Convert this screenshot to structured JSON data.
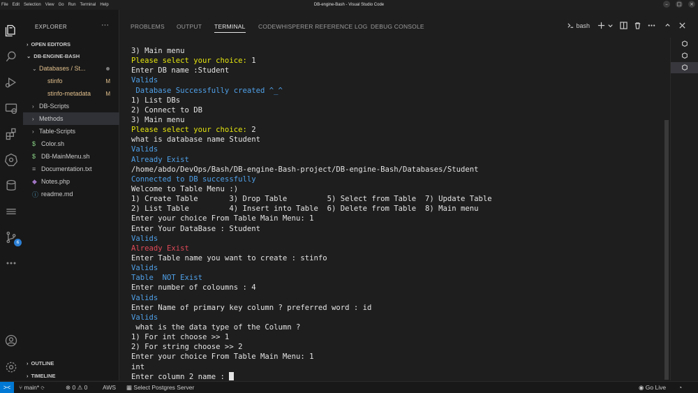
{
  "window": {
    "title": "DB-engine-Bash - Visual Studio Code",
    "menu": [
      "File",
      "Edit",
      "Selection",
      "View",
      "Go",
      "Run",
      "Terminal",
      "Help"
    ]
  },
  "activity_bar": {
    "icons": [
      "files-icon",
      "search-icon",
      "run-debug-icon",
      "remote-explorer-icon",
      "extensions-icon",
      "kubernetes-icon",
      "database-icon",
      "stack-icon",
      "source-control-icon",
      "more-icon",
      "account-icon",
      "settings-gear-icon"
    ],
    "source_control_badge": "6"
  },
  "sidebar": {
    "title": "EXPLORER",
    "more": "···",
    "open_editors": "OPEN EDITORS",
    "project": "DB-ENGINE-BASH",
    "items": [
      {
        "label": "Databases / St...",
        "type": "folder-open",
        "indent": 1,
        "status": "dot"
      },
      {
        "label": "stinfo",
        "type": "file",
        "indent": 2,
        "status": "M"
      },
      {
        "label": "stinfo-metadata",
        "type": "file",
        "indent": 2,
        "status": "M"
      },
      {
        "label": "DB-Scripts",
        "type": "folder",
        "indent": 1,
        "status": ""
      },
      {
        "label": "Methods",
        "type": "folder",
        "indent": 1,
        "status": ""
      },
      {
        "label": "Table-Scripts",
        "type": "folder",
        "indent": 1,
        "status": ""
      },
      {
        "label": "Color.sh",
        "type": "shell",
        "indent": 1,
        "status": ""
      },
      {
        "label": "DB-MainMenu.sh",
        "type": "shell",
        "indent": 1,
        "status": ""
      },
      {
        "label": "Documentation.txt",
        "type": "text",
        "indent": 1,
        "status": ""
      },
      {
        "label": "Notes.php",
        "type": "php",
        "indent": 1,
        "status": ""
      },
      {
        "label": "readme.md",
        "type": "info",
        "indent": 1,
        "status": ""
      }
    ],
    "outline": "OUTLINE",
    "timeline": "TIMELINE"
  },
  "panel": {
    "tabs": [
      "PROBLEMS",
      "OUTPUT",
      "TERMINAL",
      "CODEWHISPERER REFERENCE LOG",
      "DEBUG CONSOLE"
    ],
    "active_tab": "TERMINAL",
    "shell_label": "bash"
  },
  "terminal": {
    "lines": [
      {
        "text": "3) Main menu",
        "color": "default"
      },
      {
        "text": "Please select your choice: ",
        "color": "yellow",
        "suffix": "1"
      },
      {
        "text": "Enter DB name :Student",
        "color": "default"
      },
      {
        "text": "Valids",
        "color": "blue"
      },
      {
        "text": " Database Successfully created ^_^",
        "color": "blue"
      },
      {
        "text": "1) List DBs",
        "color": "default"
      },
      {
        "text": "2) Connect to DB",
        "color": "default"
      },
      {
        "text": "3) Main menu",
        "color": "default"
      },
      {
        "text": "Please select your choice: ",
        "color": "yellow",
        "suffix": "2"
      },
      {
        "text": "what is database name Student",
        "color": "default"
      },
      {
        "text": "Valids",
        "color": "blue"
      },
      {
        "text": "Already Exist",
        "color": "blue"
      },
      {
        "text": "/home/abdo/DevOps/Bash/DB-engine-Bash-project/DB-engine-Bash/Databases/Student",
        "color": "default"
      },
      {
        "text": "Connected to DB successfully",
        "color": "blue"
      },
      {
        "text": "Welcome to Table Menu :)",
        "color": "default"
      },
      {
        "text": "1) Create Table       3) Drop Table         5) Select from Table  7) Update Table",
        "color": "default"
      },
      {
        "text": "2) List Table         4) Insert into Table  6) Delete from Table  8) Main menu",
        "color": "default"
      },
      {
        "text": "Enter your choice From Table Main Menu: 1",
        "color": "default"
      },
      {
        "text": "Enter Your DataBase : Student",
        "color": "default"
      },
      {
        "text": "Valids",
        "color": "blue"
      },
      {
        "text": "Already Exist",
        "color": "red"
      },
      {
        "text": "Enter Table name you want to create : stinfo",
        "color": "default"
      },
      {
        "text": "Valids",
        "color": "blue"
      },
      {
        "text": "Table  NOT Exist",
        "color": "blue"
      },
      {
        "text": "Enter number of coloumns : 4",
        "color": "default"
      },
      {
        "text": "Valids",
        "color": "blue"
      },
      {
        "text": "Enter Name of primary key column ? preferred word : id",
        "color": "default"
      },
      {
        "text": "Valids",
        "color": "blue"
      },
      {
        "text": " what is the data type of the Column ?",
        "color": "default"
      },
      {
        "text": "1) For int choose >> 1",
        "color": "default"
      },
      {
        "text": "2) For string choose >> 2",
        "color": "default"
      },
      {
        "text": "Enter your choice From Table Main Menu: 1",
        "color": "default"
      },
      {
        "text": "int",
        "color": "default"
      },
      {
        "text": "Enter column 2 name : ",
        "color": "default",
        "cursor": true
      }
    ]
  },
  "status_bar": {
    "remote": "><",
    "branch": "main*",
    "errors": "0",
    "warnings": "0",
    "aws": "AWS",
    "postgres": "Select Postgres Server",
    "golive": "Go Live"
  },
  "colors": {
    "accent": "#0078d4",
    "yellow": "#e5e510",
    "blue": "#4fa0e8",
    "red": "#e04958"
  }
}
